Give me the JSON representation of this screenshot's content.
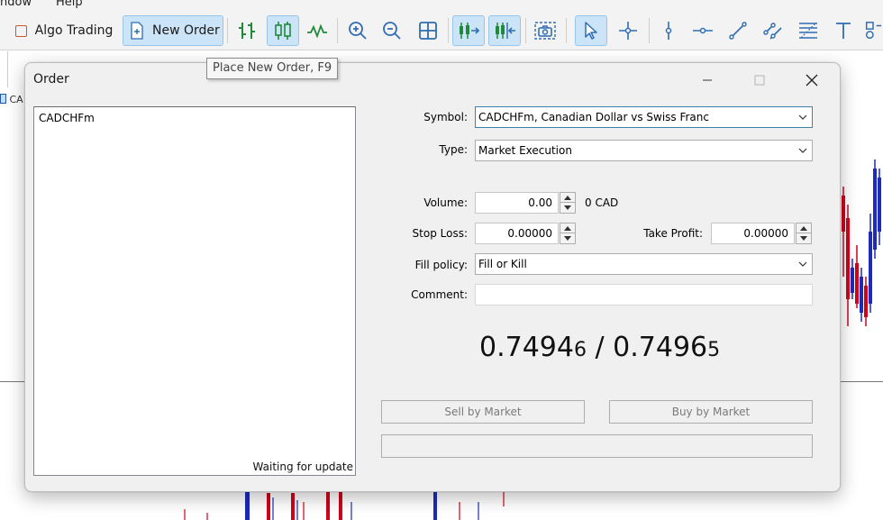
{
  "menubar": {
    "items": [
      "ndow",
      "Help"
    ]
  },
  "toolbar": {
    "algo_trading_label": "Algo Trading",
    "new_order_label": "New Order",
    "icons": [
      "bar-chart-icon",
      "candlestick-chart-icon",
      "line-chart-icon",
      "zoom-in-icon",
      "zoom-out-icon",
      "tile-windows-icon",
      "auto-scroll-icon",
      "chart-shift-icon",
      "screenshot-icon",
      "cursor-icon",
      "crosshair-icon",
      "vertical-line-icon",
      "horizontal-line-icon",
      "trend-line-icon",
      "equidistant-channel-icon",
      "fibonacci-icon",
      "text-icon",
      "shapes-icon"
    ]
  },
  "tooltip": {
    "text": "Place New Order, F9"
  },
  "chart": {
    "tab_label": "CA"
  },
  "dialog": {
    "title": "Order",
    "left_panel": {
      "symbol": "CADCHFm",
      "status": "Waiting for update"
    },
    "form": {
      "symbol_label": "Symbol:",
      "symbol_value": "CADCHFm, Canadian Dollar vs Swiss Franc",
      "type_label": "Type:",
      "type_value": "Market Execution",
      "volume_label": "Volume:",
      "volume_value": "0.00",
      "volume_unit": "0 CAD",
      "stop_loss_label": "Stop Loss:",
      "stop_loss_value": "0.00000",
      "take_profit_label": "Take Profit:",
      "take_profit_value": "0.00000",
      "fill_policy_label": "Fill policy:",
      "fill_policy_value": "Fill or Kill",
      "comment_label": "Comment:",
      "comment_value": ""
    },
    "price": {
      "bid_main": "0.7494",
      "bid_small": "6",
      "separator": " / ",
      "ask_main": "0.7496",
      "ask_small": "5"
    },
    "buttons": {
      "sell": "Sell by Market",
      "buy": "Buy by Market"
    }
  },
  "colors": {
    "accent": "#3c7fb1",
    "toolbar_icon": "#1f8a3a",
    "active_bg": "#cce4f7",
    "bear_candle": "#d0021b",
    "bull_candle": "#1c2bb8"
  }
}
